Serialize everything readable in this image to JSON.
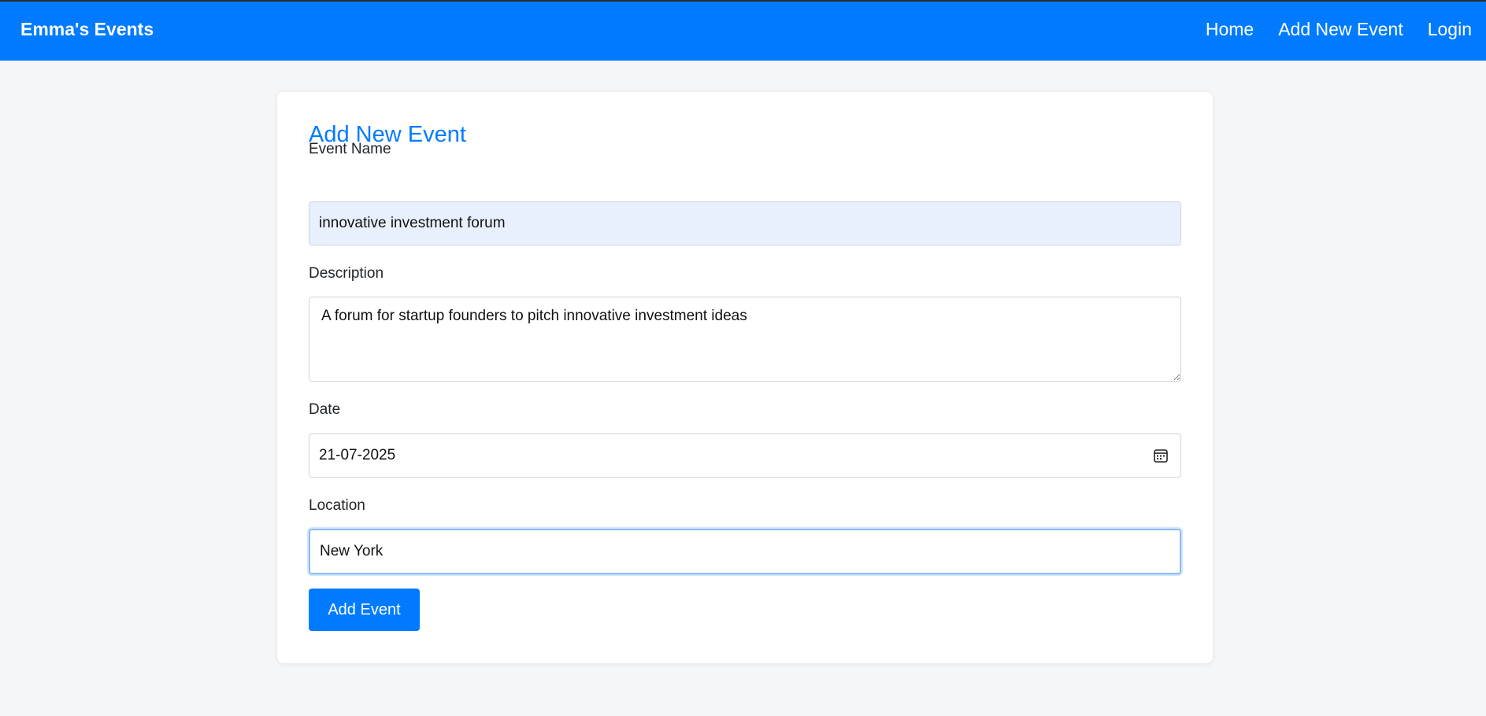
{
  "navbar": {
    "brand": "Emma's Events",
    "links": [
      "Home",
      "Add New Event",
      "Login"
    ],
    "background": "#007bff"
  },
  "form": {
    "title": "Add New Event",
    "event_name": {
      "label": "Event Name",
      "value": "innovative investment forum"
    },
    "description": {
      "label": "Description",
      "value": "A forum for startup founders to pitch innovative investment ideas"
    },
    "date": {
      "label": "Date",
      "value": "21-07-2025",
      "icon": "calendar-icon"
    },
    "location": {
      "label": "Location",
      "value": "New York"
    },
    "submit_label": "Add Event"
  },
  "colors": {
    "accent": "#007bff",
    "page_background": "#f5f6f7",
    "autofill_background": "#e8f0fe"
  }
}
